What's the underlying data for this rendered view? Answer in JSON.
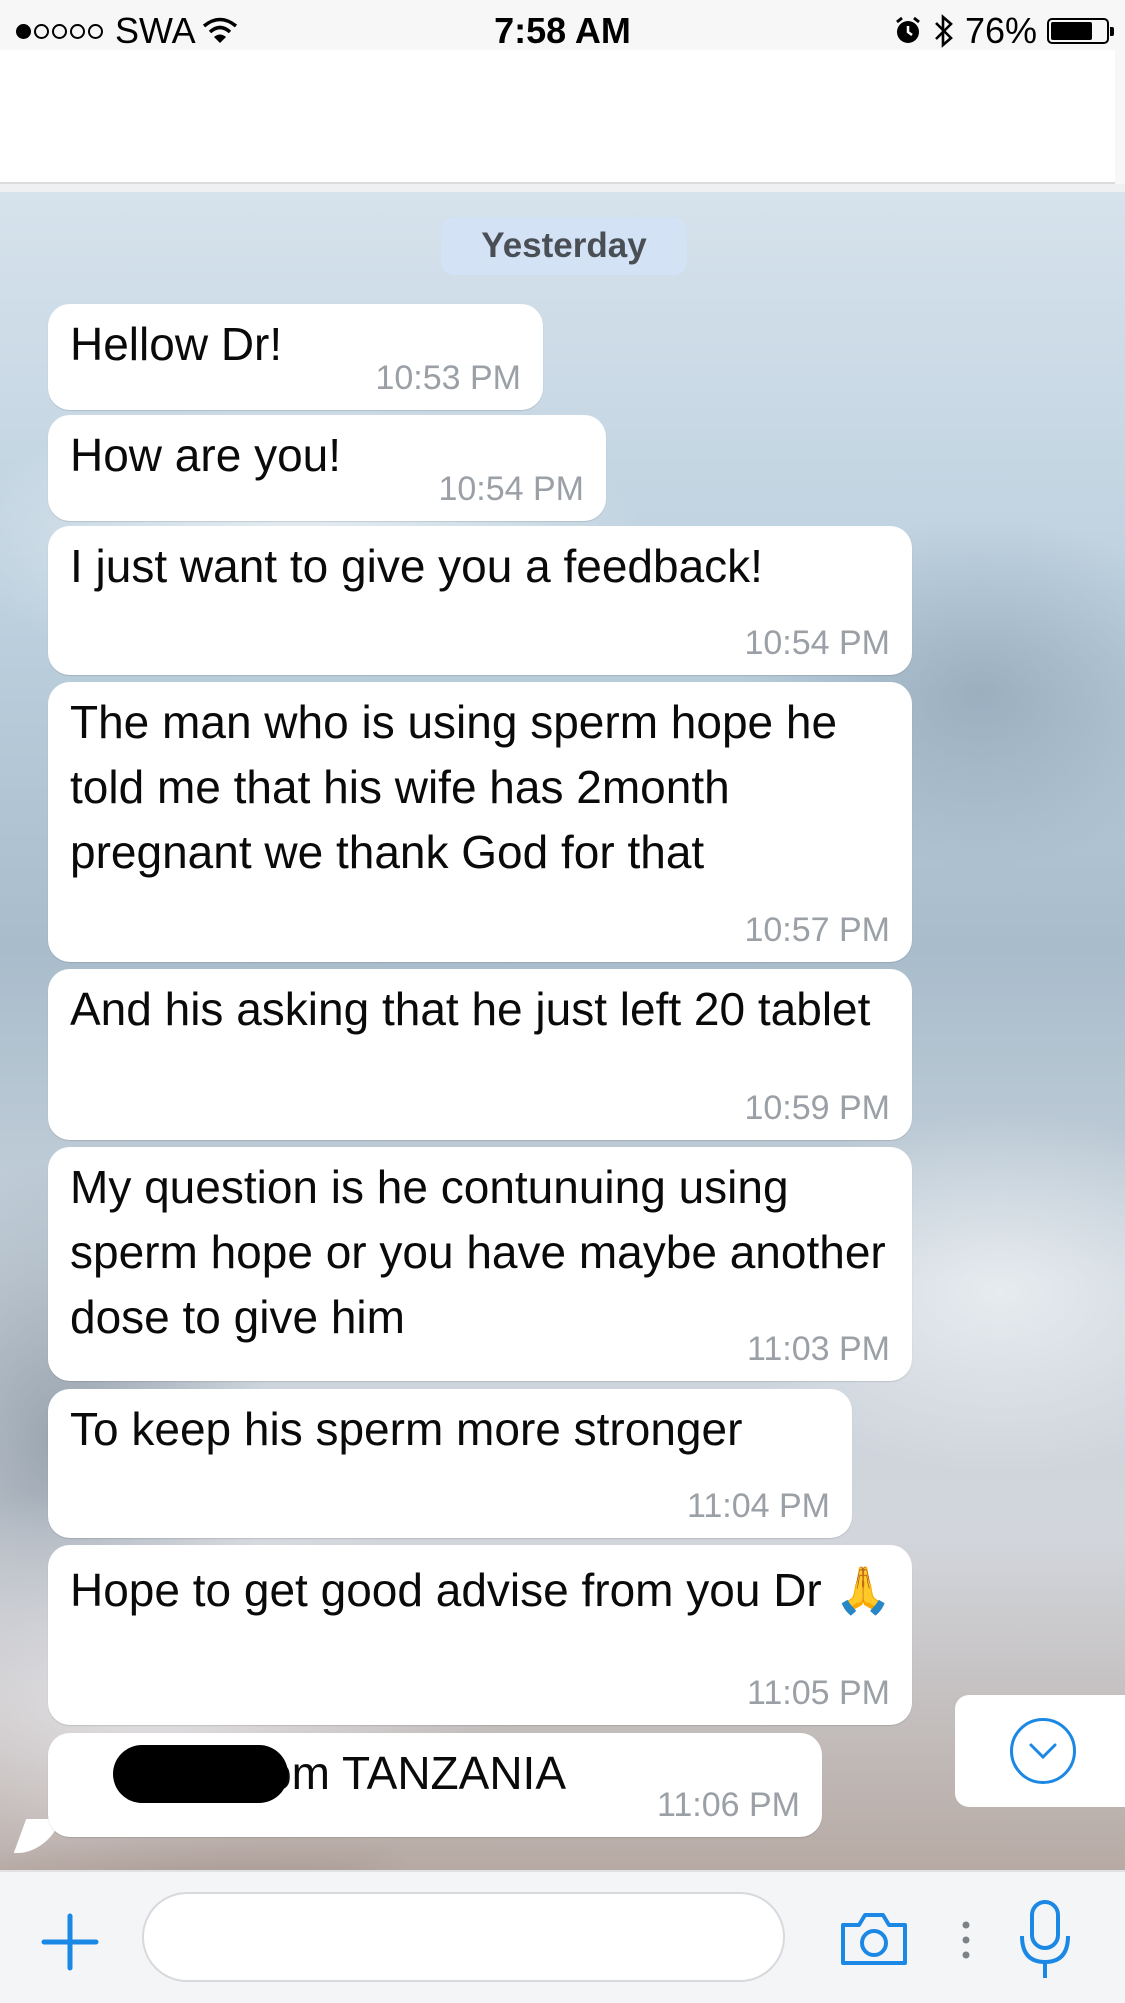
{
  "status_bar": {
    "carrier": "SWA",
    "time": "7:58 AM",
    "battery": "76%"
  },
  "chat": {
    "date_label": "Yesterday",
    "messages": [
      {
        "text": "Hellow Dr!",
        "time": "10:53 PM"
      },
      {
        "text": "How are you!",
        "time": "10:54 PM"
      },
      {
        "text": "I just want to give you a feedback!",
        "time": "10:54 PM"
      },
      {
        "text": "The man who is using sperm hope he told me that his wife has 2month pregnant we thank God for that",
        "time": "10:57 PM"
      },
      {
        "text": "And his asking that he just left 20 tablet",
        "time": "10:59 PM"
      },
      {
        "text": "My question is he contunuing using sperm hope or you have maybe another dose to give him",
        "time": "11:03 PM"
      },
      {
        "text": "To keep his sperm more stronger",
        "time": "11:04 PM"
      },
      {
        "text": "Hope to get good advise from you Dr 🙏",
        "time": "11:05 PM"
      },
      {
        "text": "from TANZANIA",
        "time": "11:06 PM"
      }
    ]
  },
  "composer": {
    "placeholder": ""
  },
  "colors": {
    "accent": "#1c88e5",
    "date_pill": "#d4e2f6",
    "bubble": "#ffffff",
    "timestamp": "#9aa0a6"
  },
  "icons": [
    "wifi-icon",
    "alarm-icon",
    "bluetooth-icon",
    "battery-icon",
    "scroll-down-icon",
    "plus-icon",
    "camera-icon",
    "more-icon",
    "microphone-icon"
  ]
}
